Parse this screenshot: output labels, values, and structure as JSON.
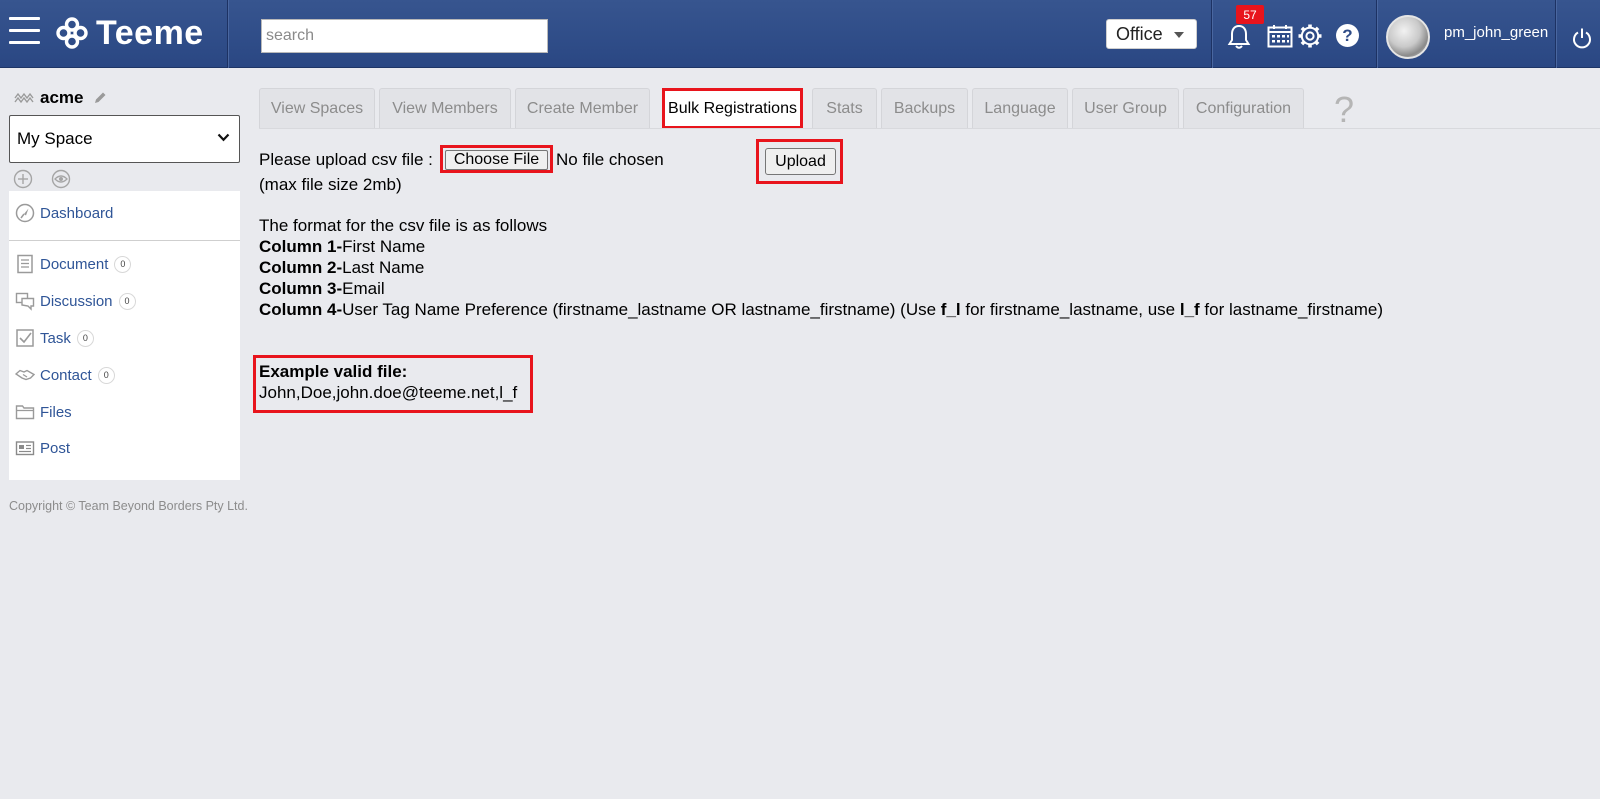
{
  "header": {
    "app_name": "Teeme",
    "search_placeholder": "search",
    "office_label": "Office",
    "notification_count": "57",
    "help_label": "?",
    "username": "pm_john_green",
    "icons": [
      "menu-icon",
      "teeme-logo-icon",
      "bell-icon",
      "calendar-icon",
      "gear-icon",
      "help-icon",
      "power-icon"
    ]
  },
  "sidebar": {
    "space_name": "acme",
    "space_selector_value": "My Space",
    "dashboard_label": "Dashboard",
    "items": [
      {
        "label": "Document",
        "count": "0",
        "icon": "document-icon"
      },
      {
        "label": "Discussion",
        "count": "0",
        "icon": "discussion-icon"
      },
      {
        "label": "Task",
        "count": "0",
        "icon": "task-icon"
      },
      {
        "label": "Contact",
        "count": "0",
        "icon": "contact-icon"
      },
      {
        "label": "Files",
        "icon": "folder-icon"
      },
      {
        "label": "Post",
        "icon": "post-icon"
      }
    ],
    "copyright": "Copyright © Team Beyond Borders Pty Ltd."
  },
  "tabs": [
    {
      "label": "View Spaces"
    },
    {
      "label": "View Members"
    },
    {
      "label": "Create Member"
    },
    {
      "label": "Bulk Registrations",
      "active": true
    },
    {
      "label": "Stats"
    },
    {
      "label": "Backups"
    },
    {
      "label": "Language"
    },
    {
      "label": "User Group"
    },
    {
      "label": "Configuration"
    }
  ],
  "help_question": "?",
  "upload": {
    "prompt": "Please upload csv file :",
    "choose_file_label": "Choose File",
    "no_file_text": "No file chosen",
    "upload_button": "Upload",
    "max_size_note": "(max file size 2mb)"
  },
  "format": {
    "intro": "The format for the csv file is as follows",
    "columns": [
      {
        "key": "Column 1-",
        "value": "First Name"
      },
      {
        "key": "Column 2-",
        "value": "Last Name"
      },
      {
        "key": "Column 3-",
        "value": "Email"
      },
      {
        "key": "Column 4-",
        "value": "User Tag Name Preference (firstname_lastname OR lastname_firstname) (Use "
      }
    ],
    "col4_code1": "f_l",
    "col4_mid": " for firstname_lastname, use ",
    "col4_code2": "l_f",
    "col4_end": " for lastname_firstname)"
  },
  "example": {
    "title": "Example valid file:",
    "line": "John,Doe,john.doe@teeme.net,l_f"
  },
  "colors": {
    "header_bg": "#2f4c87",
    "highlight": "#e8141c",
    "link": "#2f5597",
    "page_bg": "#e9eaee"
  }
}
